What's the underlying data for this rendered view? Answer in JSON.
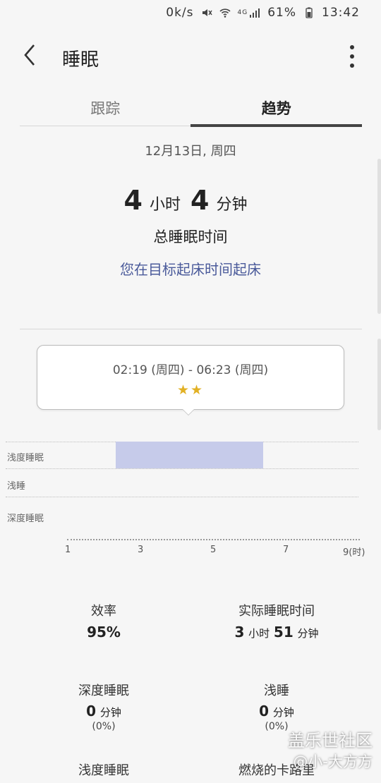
{
  "status": {
    "speed": "0k/s",
    "network": "4G",
    "battery": "61%",
    "time": "13:42"
  },
  "header": {
    "title": "睡眠"
  },
  "tabs": [
    {
      "label": "跟踪"
    },
    {
      "label": "趋势"
    }
  ],
  "summary": {
    "date": "12月13日, 周四",
    "hours": "4",
    "hours_unit": "小时",
    "minutes": "4",
    "minutes_unit": "分钟",
    "subtitle": "总睡眠时间",
    "note": "您在目标起床时间起床"
  },
  "tooltip": {
    "range": "02:19 (周四) - 06:23 (周四)",
    "stars": "★★",
    "rating": 2
  },
  "chart_data": {
    "type": "bar",
    "levels": [
      "浅度睡眠",
      "浅睡",
      "深度睡眠"
    ],
    "x_ticks": [
      "1",
      "3",
      "5",
      "7",
      "9(时)"
    ],
    "series": [
      {
        "level": "浅度睡眠",
        "start": 2.3,
        "end": 6.4
      }
    ],
    "xlim": [
      1,
      9
    ]
  },
  "stats": {
    "efficiency": {
      "label": "效率",
      "value": "95%"
    },
    "actual": {
      "label": "实际睡眠时间",
      "h": "3",
      "h_unit": "小时",
      "m": "51",
      "m_unit": "分钟"
    },
    "deep": {
      "label": "深度睡眠",
      "value": "0",
      "unit": "分钟",
      "pct": "(0%)"
    },
    "light": {
      "label": "浅睡",
      "value": "0",
      "unit": "分钟",
      "pct": "(0%)"
    },
    "shallow": {
      "label": "浅度睡眠"
    },
    "calories": {
      "label": "燃烧的卡路里"
    }
  },
  "watermark": {
    "line1": "盖乐世社区",
    "line2": "@小-大方方"
  },
  "colors": {
    "sleep_bar": "#c6cbea",
    "note": "#4a5a9a",
    "star": "#e2b125"
  }
}
